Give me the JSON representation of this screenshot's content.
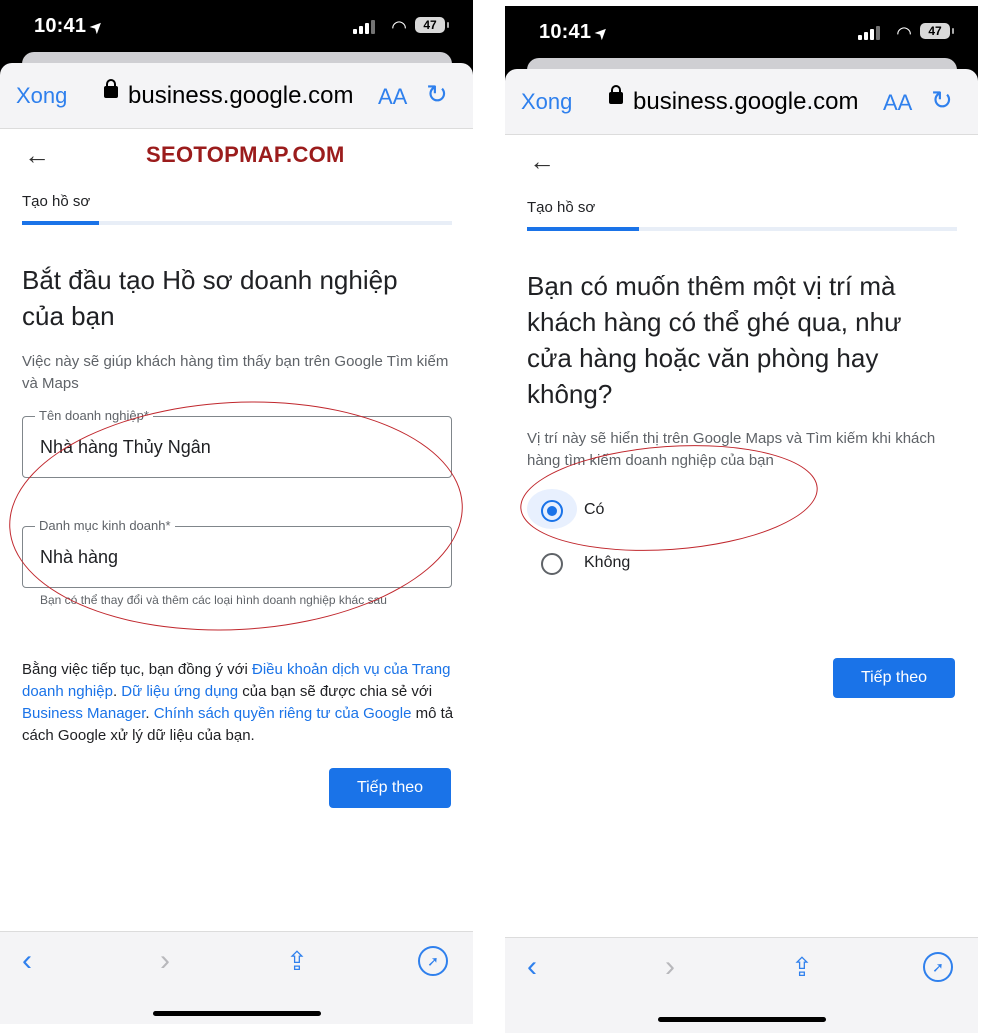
{
  "status_bar": {
    "time": "10:41",
    "battery": "47"
  },
  "browser": {
    "done_label": "Xong",
    "url": "business.google.com",
    "text_size_label": "AA"
  },
  "left": {
    "brand": "SEOTOPMAP.COM",
    "step_label": "Tạo hồ sơ",
    "progress": 0.18,
    "heading": "Bắt đầu tạo Hồ sơ doanh nghiệp của bạn",
    "subtitle": "Việc này sẽ giúp khách hàng tìm thấy bạn trên Google Tìm kiếm và Maps",
    "business_name": {
      "label": "Tên doanh nghiệp*",
      "value": "Nhà hàng Thủy Ngân"
    },
    "category": {
      "label": "Danh mục kinh doanh*",
      "value": "Nhà hàng"
    },
    "helper": "Bạn có thể thay đổi và thêm các loại hình doanh nghiệp khác sau",
    "terms": {
      "t1": "Bằng việc tiếp tục, bạn đồng ý với ",
      "l1": "Điều khoản dịch vụ của Trang doanh nghiệp",
      "t2": ". ",
      "l2": "Dữ liệu ứng dụng",
      "t3": " của bạn sẽ được chia sẻ với ",
      "l3": "Business Manager",
      "t4": ". ",
      "l4": "Chính sách quyền riêng tư của Google",
      "t5": " mô tả cách Google xử lý dữ liệu của bạn."
    },
    "next_label": "Tiếp theo"
  },
  "right": {
    "step_label": "Tạo hồ sơ",
    "progress": 0.26,
    "heading": "Bạn có muốn thêm một vị trí mà khách hàng có thể ghé qua, như cửa hàng hoặc văn phòng hay không?",
    "subtitle": "Vị trí này sẽ hiển thị trên Google Maps và Tìm kiếm khi khách hàng tìm kiếm doanh nghiệp của bạn",
    "option_yes": "Có",
    "option_no": "Không",
    "selected": "yes",
    "next_label": "Tiếp theo"
  },
  "colors": {
    "accent": "#1a73e8",
    "safari_blue": "#2f80ed",
    "brand_red": "#9b1c1c",
    "annotation_red": "#c0272d"
  },
  "icons": [
    "location-arrow-icon",
    "signal-icon",
    "wifi-icon",
    "battery-icon",
    "lock-icon",
    "reload-icon",
    "back-arrow-icon",
    "chevron-left-icon",
    "chevron-right-icon",
    "share-icon",
    "compass-icon"
  ]
}
